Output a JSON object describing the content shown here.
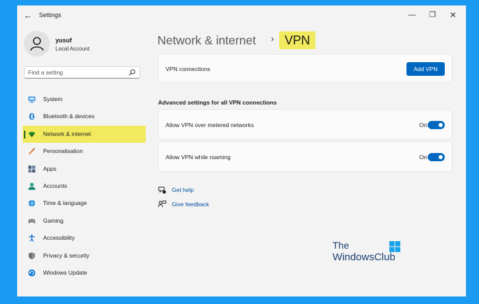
{
  "window": {
    "app_title": "Settings",
    "controls": {
      "minimize": "—",
      "maximize": "❐",
      "close": "✕"
    },
    "back_glyph": "←"
  },
  "profile": {
    "name": "yusuf",
    "account_type": "Local Account"
  },
  "search": {
    "placeholder": "Find a setting"
  },
  "sidebar": {
    "items": [
      {
        "label": "System",
        "icon": "monitor-icon",
        "color": "#0078d4"
      },
      {
        "label": "Bluetooth & devices",
        "icon": "bluetooth-icon",
        "color": "#0078d4"
      },
      {
        "label": "Network & internet",
        "icon": "wifi-icon",
        "color": "#1f7a1f",
        "active": true
      },
      {
        "label": "Personalisation",
        "icon": "brush-icon",
        "color": "#e07b39"
      },
      {
        "label": "Apps",
        "icon": "apps-icon",
        "color": "#4a5a7a"
      },
      {
        "label": "Accounts",
        "icon": "person-icon",
        "color": "#2ba58b"
      },
      {
        "label": "Time & language",
        "icon": "globe-clock-icon",
        "color": "#1a8ad4"
      },
      {
        "label": "Gaming",
        "icon": "gamepad-icon",
        "color": "#707070"
      },
      {
        "label": "Accessibility",
        "icon": "accessibility-icon",
        "color": "#1a6fc4"
      },
      {
        "label": "Privacy & security",
        "icon": "shield-icon",
        "color": "#6b6b6b"
      },
      {
        "label": "Windows Update",
        "icon": "update-icon",
        "color": "#0078d4"
      }
    ]
  },
  "header": {
    "parent": "Network & internet",
    "separator": "›",
    "current": "VPN"
  },
  "vpn_connections": {
    "label": "VPN connections",
    "button": "Add VPN"
  },
  "advanced": {
    "title": "Advanced settings for all VPN connections",
    "settings": [
      {
        "label": "Allow VPN over metered networks",
        "state": "On",
        "on": true
      },
      {
        "label": "Allow VPN while roaming",
        "state": "On",
        "on": true
      }
    ]
  },
  "links": {
    "help": "Get help",
    "feedback": "Give feedback"
  },
  "watermark": {
    "line1": "The",
    "line2": "WindowsClub"
  },
  "colors": {
    "accent": "#0067c0",
    "highlight": "#f1ea5e",
    "desktop": "#1a9af0"
  }
}
